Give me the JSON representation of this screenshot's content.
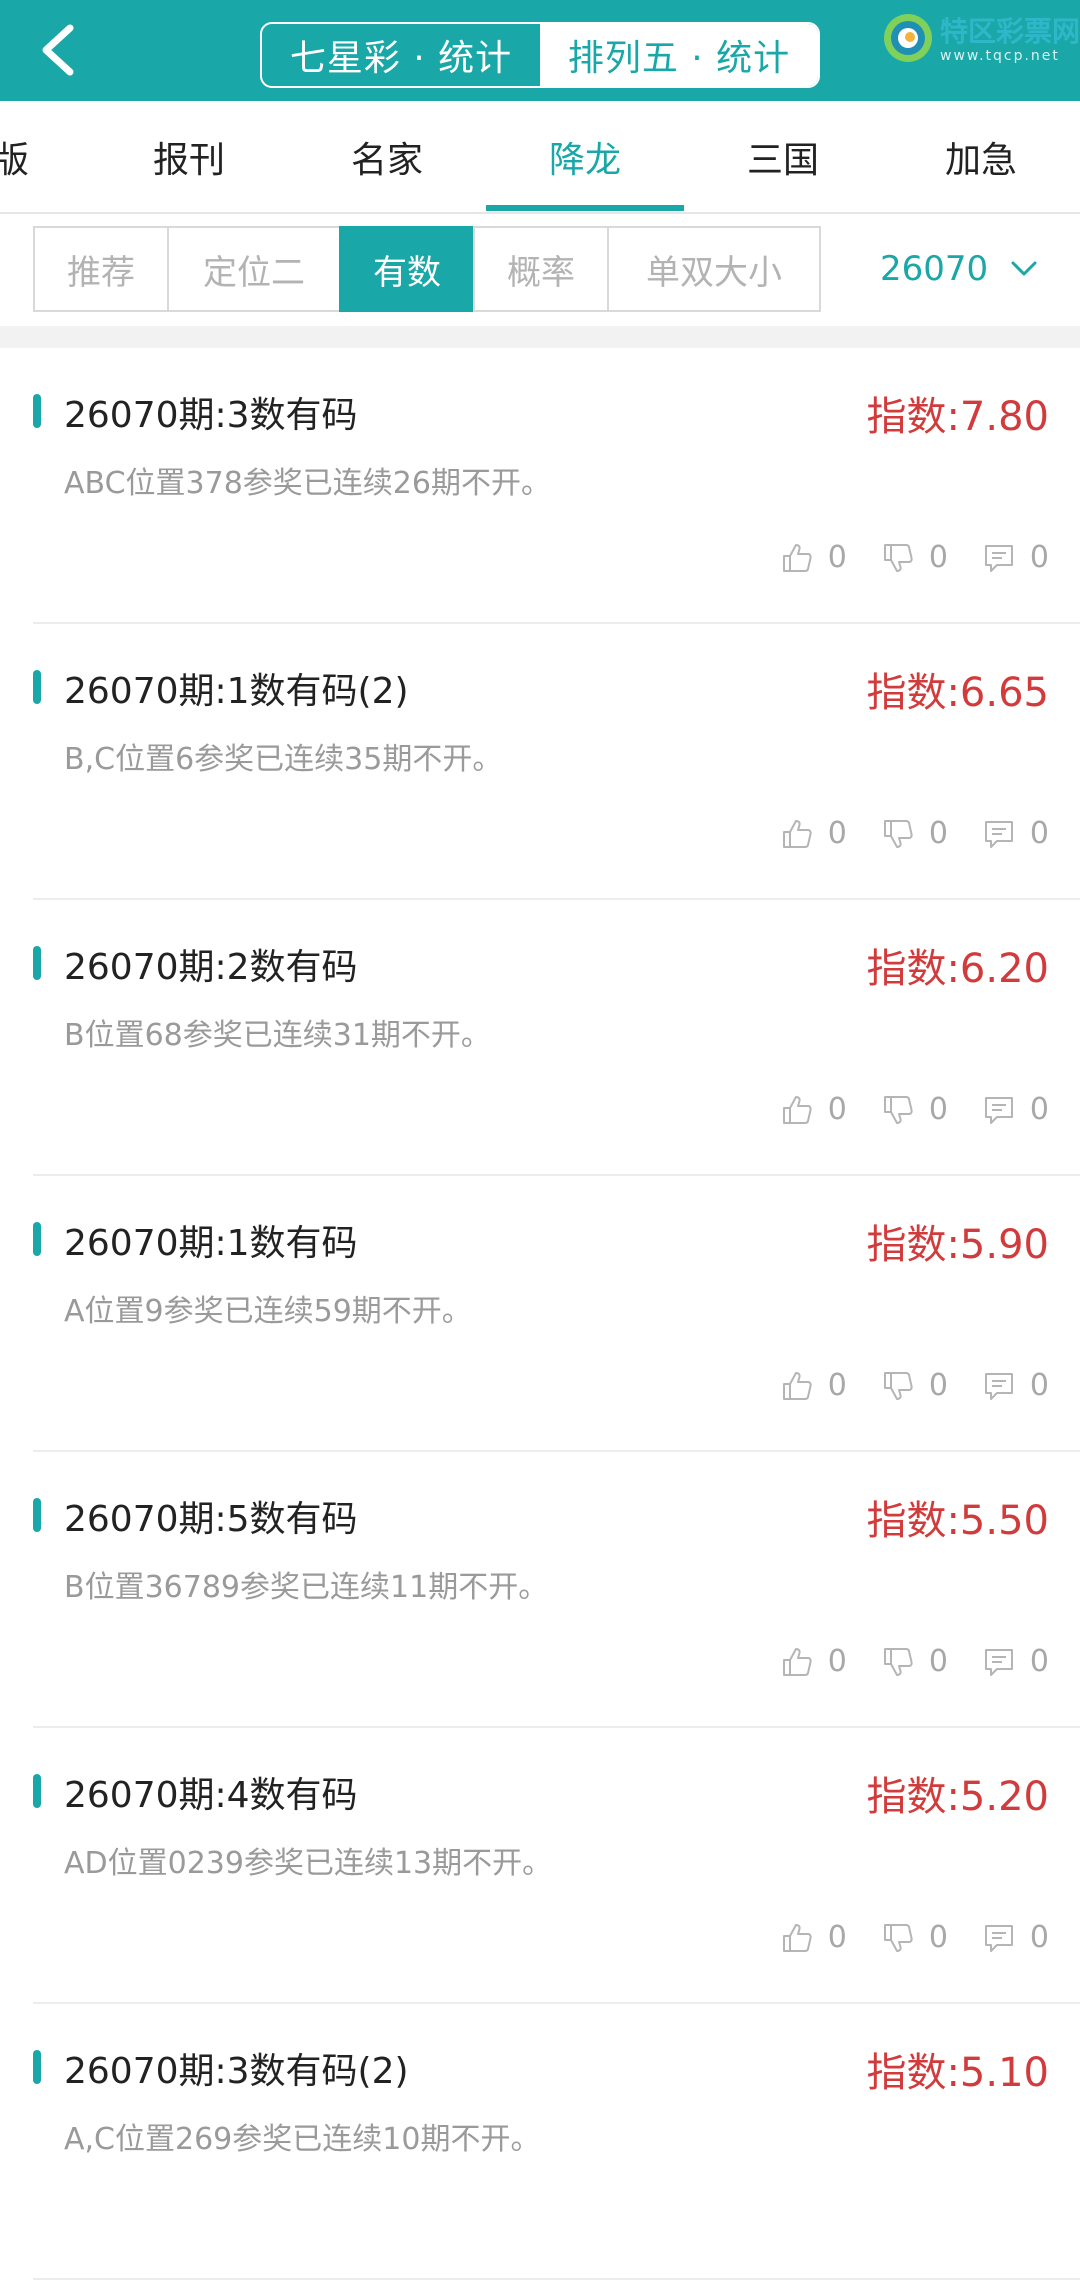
{
  "header": {
    "switch": [
      {
        "label": "七星彩 · 统计",
        "active": false
      },
      {
        "label": "排列五 · 统计",
        "active": true
      }
    ],
    "brand_name": "特区彩票网",
    "brand_url": "www.tqcp.net"
  },
  "category_tabs": [
    {
      "label": "版",
      "active": false
    },
    {
      "label": "报刊",
      "active": false
    },
    {
      "label": "名家",
      "active": false
    },
    {
      "label": "降龙",
      "active": true
    },
    {
      "label": "三国",
      "active": false
    },
    {
      "label": "加急",
      "active": false
    }
  ],
  "filters": {
    "chips": [
      {
        "label": "推荐",
        "active": false
      },
      {
        "label": "定位二",
        "active": false
      },
      {
        "label": "有数",
        "active": true
      },
      {
        "label": "概率",
        "active": false
      },
      {
        "label": "单双大小",
        "active": false
      }
    ],
    "issue": "26070"
  },
  "items": [
    {
      "title": "26070期:3数有码",
      "desc": "ABC位置378参奖已连续26期不开。",
      "index": "指数:7.80",
      "likes": "0",
      "dislikes": "0",
      "comments": "0"
    },
    {
      "title": "26070期:1数有码(2)",
      "desc": "B,C位置6参奖已连续35期不开。",
      "index": "指数:6.65",
      "likes": "0",
      "dislikes": "0",
      "comments": "0"
    },
    {
      "title": "26070期:2数有码",
      "desc": "B位置68参奖已连续31期不开。",
      "index": "指数:6.20",
      "likes": "0",
      "dislikes": "0",
      "comments": "0"
    },
    {
      "title": "26070期:1数有码",
      "desc": "A位置9参奖已连续59期不开。",
      "index": "指数:5.90",
      "likes": "0",
      "dislikes": "0",
      "comments": "0"
    },
    {
      "title": "26070期:5数有码",
      "desc": "B位置36789参奖已连续11期不开。",
      "index": "指数:5.50",
      "likes": "0",
      "dislikes": "0",
      "comments": "0"
    },
    {
      "title": "26070期:4数有码",
      "desc": "AD位置0239参奖已连续13期不开。",
      "index": "指数:5.20",
      "likes": "0",
      "dislikes": "0",
      "comments": "0"
    },
    {
      "title": "26070期:3数有码(2)",
      "desc": "A,C位置269参奖已连续10期不开。",
      "index": "指数:5.10",
      "likes": "",
      "dislikes": "",
      "comments": ""
    }
  ],
  "icons": {
    "back": "chevron-left-icon",
    "like": "thumbs-up-icon",
    "dislike": "thumbs-down-icon",
    "comment": "comment-icon",
    "dropdown": "chevron-down-icon"
  },
  "colors": {
    "accent": "#1aa7a7",
    "index_red": "#d23b3b",
    "muted": "#9a9a9a"
  }
}
